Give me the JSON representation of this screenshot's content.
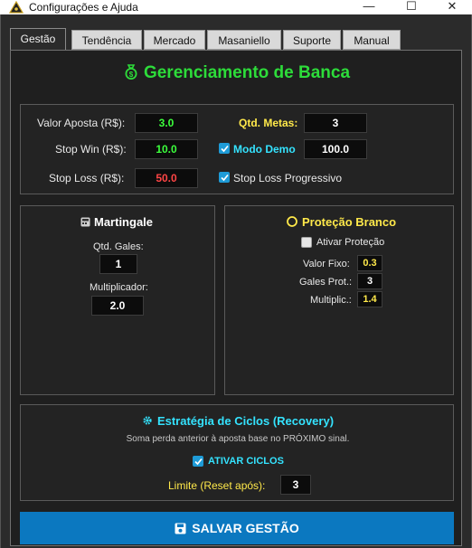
{
  "window": {
    "title": "Configurações e Ajuda",
    "min": "—",
    "max": "☐",
    "close": "✕"
  },
  "tabs": [
    "Gestão",
    "Tendência",
    "Mercado",
    "Masaniello",
    "Suporte",
    "Manual"
  ],
  "active_tab": "Gestão",
  "header": {
    "title": "Gerenciamento de Banca",
    "icon": "money-bag-icon"
  },
  "banca": {
    "valor_aposta_label": "Valor Aposta (R$):",
    "valor_aposta": "3.0",
    "stop_win_label": "Stop Win (R$):",
    "stop_win": "10.0",
    "stop_loss_label": "Stop Loss (R$):",
    "stop_loss": "50.0",
    "qtd_metas_label": "Qtd. Metas:",
    "qtd_metas": "3",
    "modo_demo_label": "Modo Demo",
    "modo_demo_checked": true,
    "modo_demo_value": "100.0",
    "stop_loss_prog_label": "Stop Loss Progressivo",
    "stop_loss_prog_checked": true
  },
  "martingale": {
    "title": "Martingale",
    "qtd_gales_label": "Qtd. Gales:",
    "qtd_gales": "1",
    "multiplicador_label": "Multiplicador:",
    "multiplicador": "2.0"
  },
  "protecao": {
    "title": "Proteção Branco",
    "ativar_label": "Ativar Proteção",
    "ativar_checked": false,
    "valor_fixo_label": "Valor Fixo:",
    "valor_fixo": "0.3",
    "gales_prot_label": "Gales Prot.:",
    "gales_prot": "3",
    "multiplic_label": "Multiplic.:",
    "multiplic": "1.4"
  },
  "ciclos": {
    "title": "Estratégia de Ciclos (Recovery)",
    "description": "Soma perda anterior à aposta base no PRÓXIMO sinal.",
    "ativar_label": "ATIVAR CICLOS",
    "ativar_checked": true,
    "limite_label": "Limite (Reset após):",
    "limite": "3"
  },
  "save_button": "SALVAR GESTÃO",
  "colors": {
    "accent_green": "#2ddc3a",
    "accent_blue": "#0b78c0",
    "cyan": "#34e3ff",
    "yellow": "#ffe94a",
    "red": "#ff4545"
  }
}
